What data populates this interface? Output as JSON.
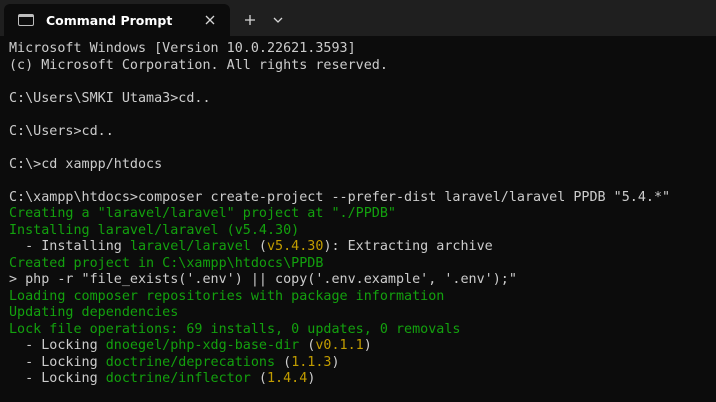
{
  "window": {
    "tab_title": "Command Prompt",
    "icons": {
      "tab": "console-icon",
      "close": "close-icon",
      "new_tab": "plus-icon",
      "dropdown": "chevron-down-icon"
    }
  },
  "colors": {
    "background": "#0c0c0c",
    "titlebar": "#1f1f1f",
    "text": "#cccccc",
    "green": "#13a10e",
    "yellow": "#c19c00"
  },
  "terminal": {
    "lines": [
      {
        "segments": [
          {
            "text": "Microsoft Windows [Version 10.0.22621.3593]",
            "color": "white"
          }
        ]
      },
      {
        "segments": [
          {
            "text": "(c) Microsoft Corporation. All rights reserved.",
            "color": "white"
          }
        ]
      },
      {
        "segments": []
      },
      {
        "segments": [
          {
            "text": "C:\\Users\\SMKI Utama3>cd..",
            "color": "white"
          }
        ]
      },
      {
        "segments": []
      },
      {
        "segments": [
          {
            "text": "C:\\Users>cd..",
            "color": "white"
          }
        ]
      },
      {
        "segments": []
      },
      {
        "segments": [
          {
            "text": "C:\\>cd xampp/htdocs",
            "color": "white"
          }
        ]
      },
      {
        "segments": []
      },
      {
        "segments": [
          {
            "text": "C:\\xampp\\htdocs>composer create-project --prefer-dist laravel/laravel PPDB \"5.4.*\"",
            "color": "white"
          }
        ]
      },
      {
        "segments": [
          {
            "text": "Creating a \"laravel/laravel\" project at \"./PPDB\"",
            "color": "green"
          }
        ]
      },
      {
        "segments": [
          {
            "text": "Installing laravel/laravel (v5.4.30)",
            "color": "green"
          }
        ]
      },
      {
        "segments": [
          {
            "text": "  - Installing ",
            "color": "white"
          },
          {
            "text": "laravel/laravel",
            "color": "green"
          },
          {
            "text": " (",
            "color": "white"
          },
          {
            "text": "v5.4.30",
            "color": "yellow"
          },
          {
            "text": "): Extracting archive",
            "color": "white"
          }
        ]
      },
      {
        "segments": [
          {
            "text": "Created project in C:\\xampp\\htdocs\\PPDB",
            "color": "green"
          }
        ]
      },
      {
        "segments": [
          {
            "text": "> php -r \"file_exists('.env') || copy('.env.example', '.env');\"",
            "color": "white"
          }
        ]
      },
      {
        "segments": [
          {
            "text": "Loading composer repositories with package information",
            "color": "green"
          }
        ]
      },
      {
        "segments": [
          {
            "text": "Updating dependencies",
            "color": "green"
          }
        ]
      },
      {
        "segments": [
          {
            "text": "Lock file operations: 69 installs, 0 updates, 0 removals",
            "color": "green"
          }
        ]
      },
      {
        "segments": [
          {
            "text": "  - Locking ",
            "color": "white"
          },
          {
            "text": "dnoegel/php-xdg-base-dir",
            "color": "green"
          },
          {
            "text": " (",
            "color": "white"
          },
          {
            "text": "v0.1.1",
            "color": "yellow"
          },
          {
            "text": ")",
            "color": "white"
          }
        ]
      },
      {
        "segments": [
          {
            "text": "  - Locking ",
            "color": "white"
          },
          {
            "text": "doctrine/deprecations",
            "color": "green"
          },
          {
            "text": " (",
            "color": "white"
          },
          {
            "text": "1.1.3",
            "color": "yellow"
          },
          {
            "text": ")",
            "color": "white"
          }
        ]
      },
      {
        "segments": [
          {
            "text": "  - Locking ",
            "color": "white"
          },
          {
            "text": "doctrine/inflector",
            "color": "green"
          },
          {
            "text": " (",
            "color": "white"
          },
          {
            "text": "1.4.4",
            "color": "yellow"
          },
          {
            "text": ")",
            "color": "white"
          }
        ]
      }
    ]
  }
}
